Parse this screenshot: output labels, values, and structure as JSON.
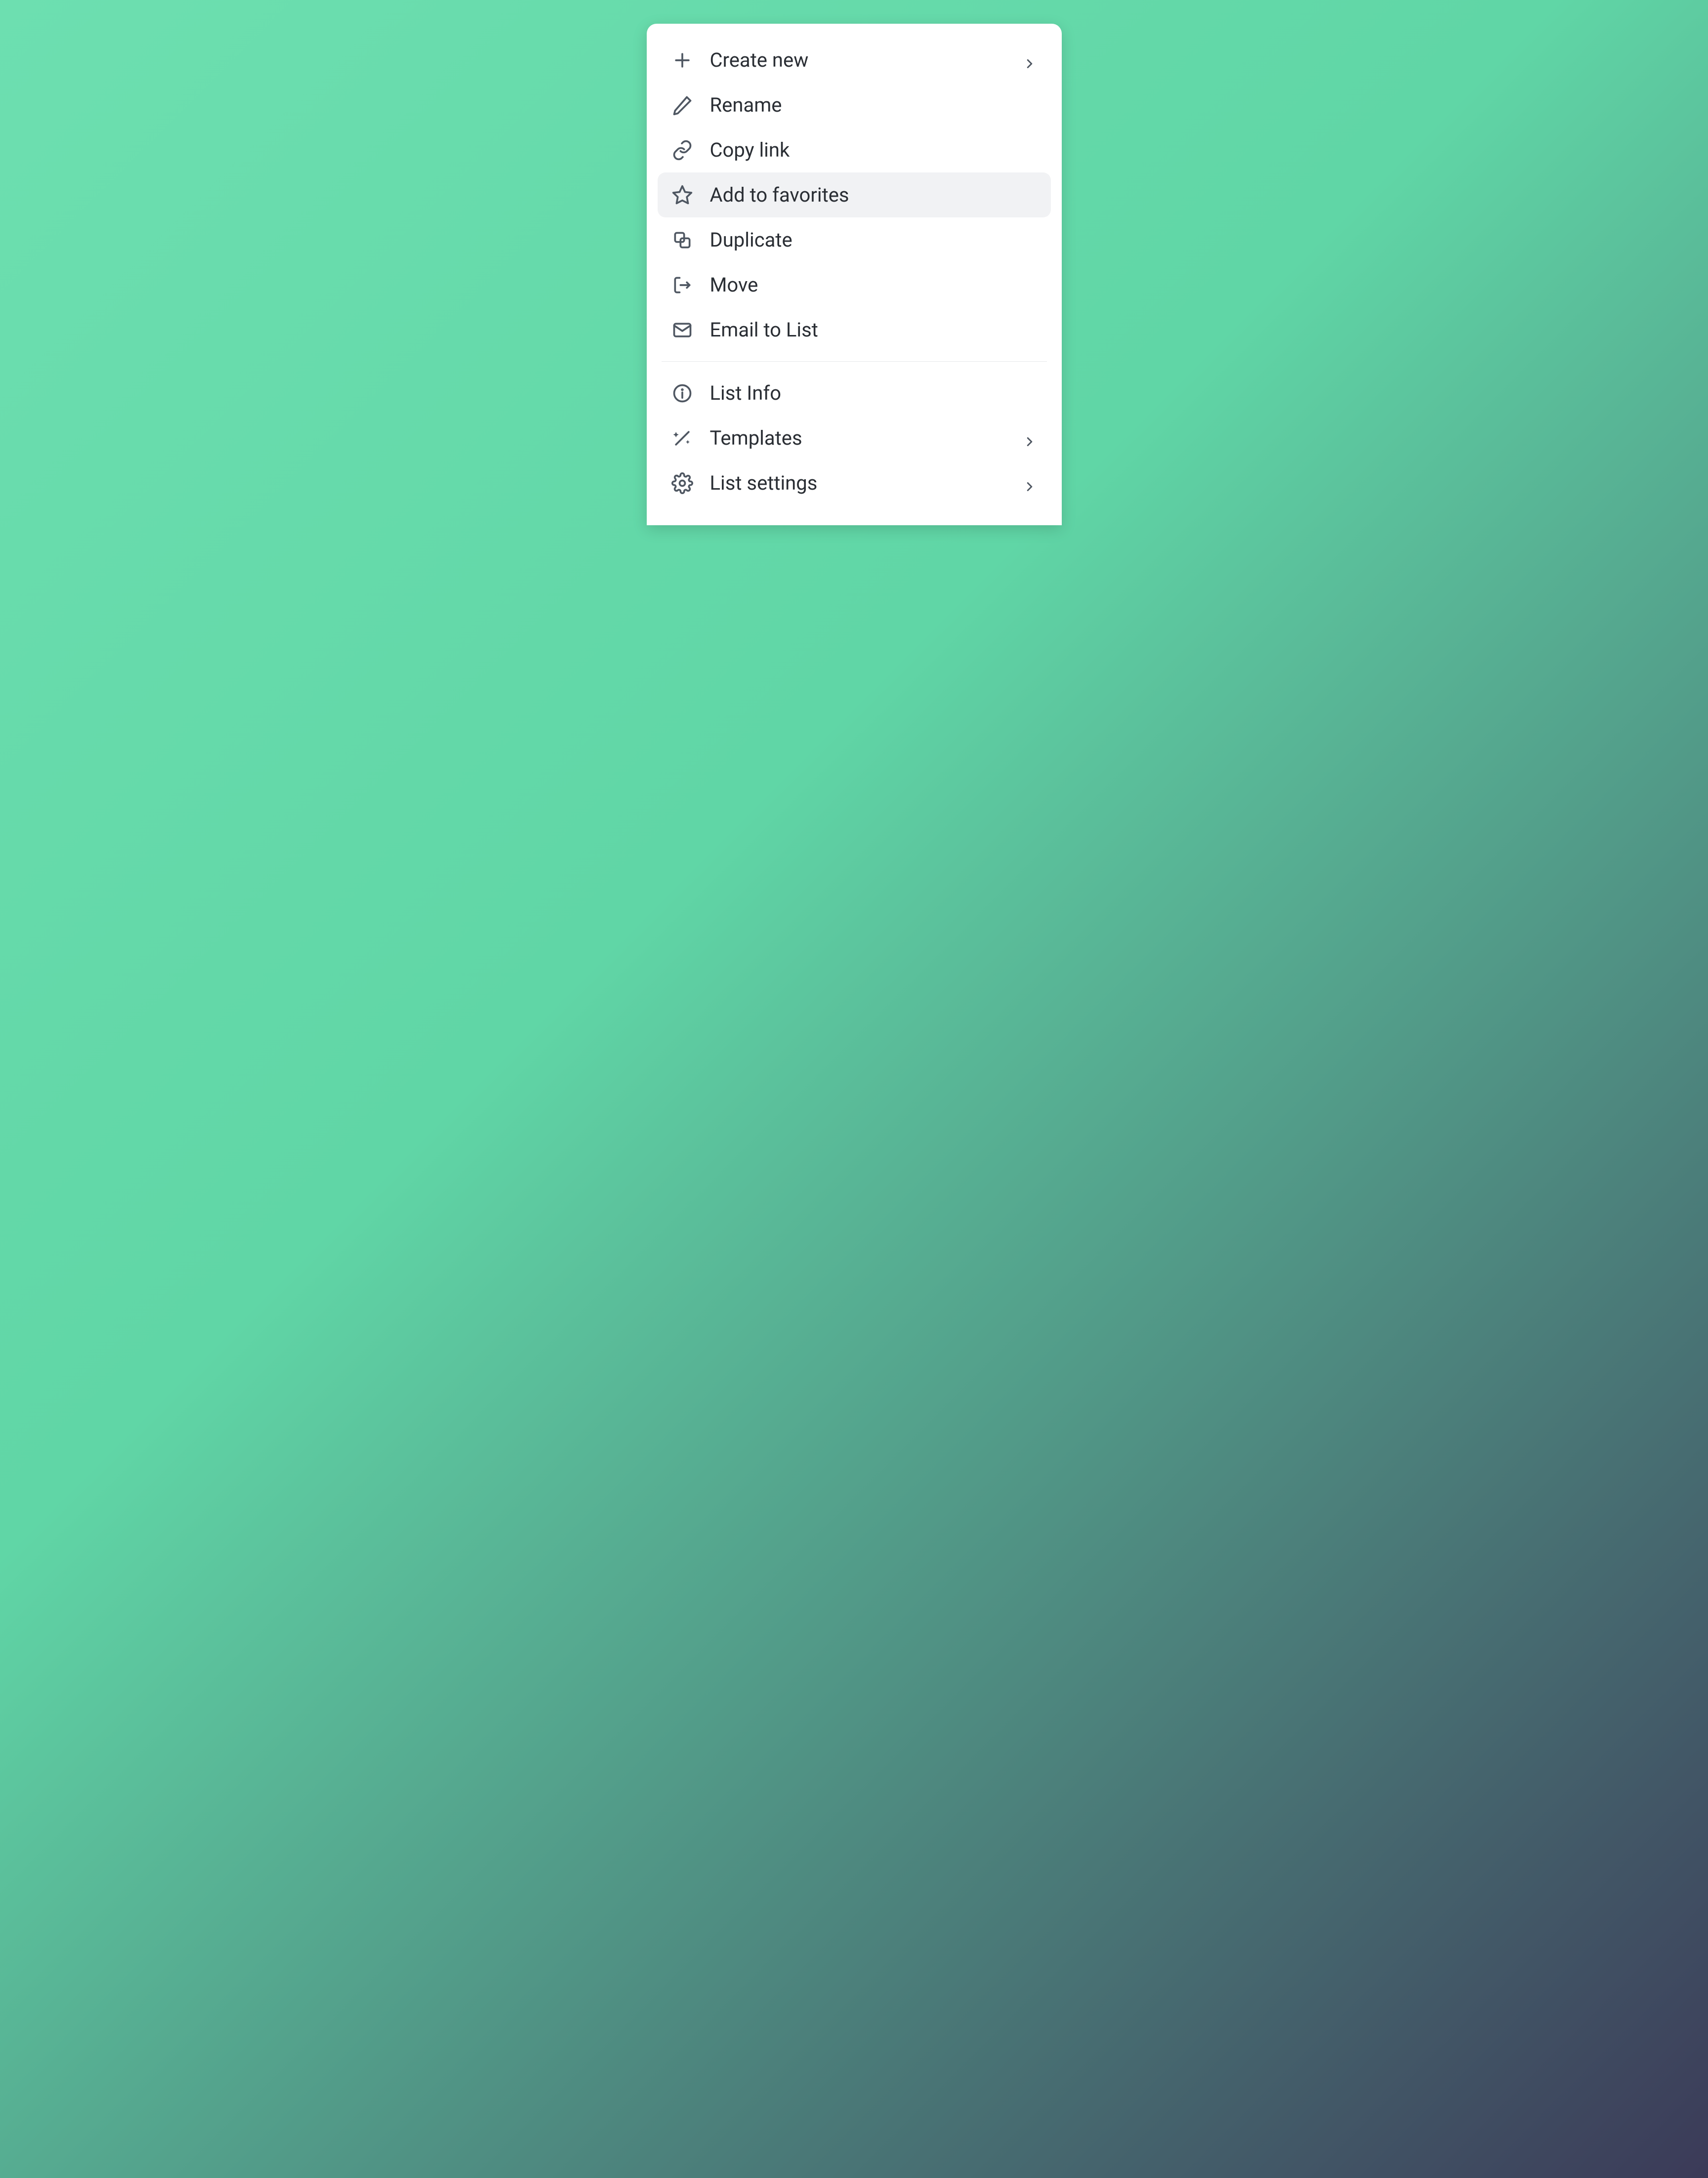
{
  "menu": {
    "items": [
      {
        "label": "Create new",
        "chevron": true,
        "hover": false
      },
      {
        "label": "Rename",
        "chevron": false,
        "hover": false
      },
      {
        "label": "Copy link",
        "chevron": false,
        "hover": false
      },
      {
        "label": "Add to favorites",
        "chevron": false,
        "hover": true
      },
      {
        "label": "Duplicate",
        "chevron": false,
        "hover": false
      },
      {
        "label": "Move",
        "chevron": false,
        "hover": false
      },
      {
        "label": "Email to List",
        "chevron": false,
        "hover": false
      }
    ],
    "items2": [
      {
        "label": "List Info",
        "chevron": false
      },
      {
        "label": "Templates",
        "chevron": true
      },
      {
        "label": "List settings",
        "chevron": true
      }
    ]
  }
}
